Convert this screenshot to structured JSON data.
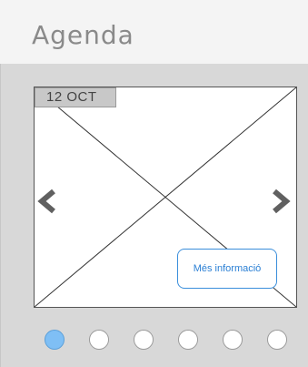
{
  "header": {
    "title": "Agenda"
  },
  "carousel": {
    "date": "12  OCT",
    "more_button": "Més informació",
    "dot_count": 6,
    "active_index": 0
  },
  "colors": {
    "accent": "#3a8edb",
    "active_dot": "#7fbff5",
    "arrow": "#606060"
  },
  "icons": {
    "prev": "chevron-left-icon",
    "next": "chevron-right-icon"
  }
}
